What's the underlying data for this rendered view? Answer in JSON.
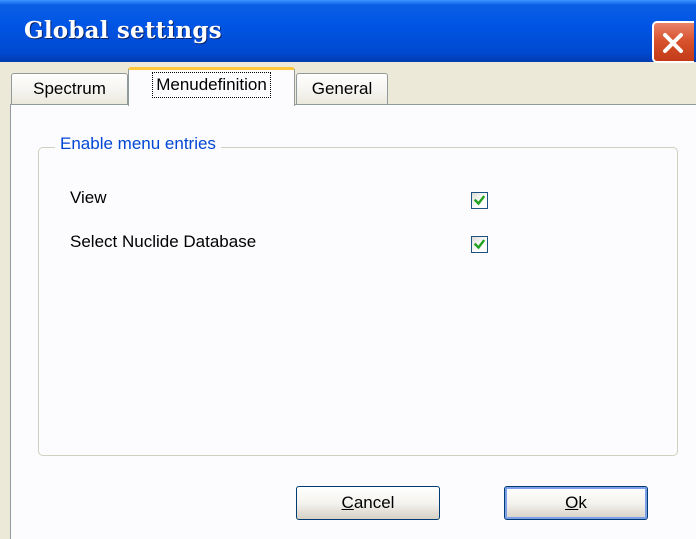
{
  "window": {
    "title": "Global settings"
  },
  "tabs": [
    {
      "label": "Spectrum",
      "active": false
    },
    {
      "label": "Menudefinition",
      "active": true
    },
    {
      "label": "General",
      "active": false
    }
  ],
  "group": {
    "label": "Enable menu entries",
    "items": [
      {
        "label": "View",
        "checked": true
      },
      {
        "label": "Select Nuclide Database",
        "checked": true
      }
    ]
  },
  "buttons": {
    "cancel": {
      "accel": "C",
      "rest": "ancel"
    },
    "ok": {
      "accel": "O",
      "rest": "k"
    }
  },
  "icons": {
    "close": "close-icon",
    "check": "checkmark-icon"
  },
  "colors": {
    "titlebar": "#0055e5",
    "group_label": "#0046d5",
    "check": "#21a121",
    "close": "#d8532e"
  }
}
